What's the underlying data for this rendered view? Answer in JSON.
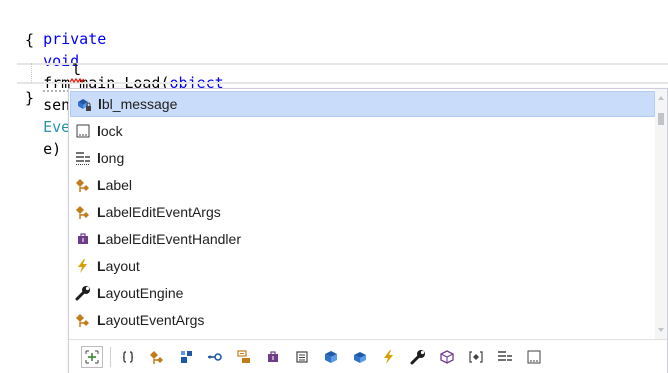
{
  "editor": {
    "line1": {
      "keyword_private": "private",
      "keyword_void": "void",
      "method_name": "frm_main_Load",
      "paren_open": "(",
      "keyword_object": "object",
      "param_sender": "sender",
      "comma": ",",
      "type_eventargs": "EventArgs",
      "param_e": "e",
      "paren_close": ")"
    },
    "open_brace": "{",
    "typed_text": "l",
    "close_brace": "}"
  },
  "completion": {
    "items": [
      {
        "prefix": "l",
        "rest": "bl_message",
        "icon": "private-field-icon",
        "selected": true
      },
      {
        "prefix": "l",
        "rest": "ock",
        "icon": "keyword-icon",
        "selected": false
      },
      {
        "prefix": "l",
        "rest": "ong",
        "icon": "keyword-struct-icon",
        "selected": false
      },
      {
        "prefix": "L",
        "rest": "abel",
        "icon": "class-icon",
        "selected": false
      },
      {
        "prefix": "L",
        "rest": "abelEditEventArgs",
        "icon": "class-icon",
        "selected": false
      },
      {
        "prefix": "L",
        "rest": "abelEditEventHandler",
        "icon": "delegate-icon",
        "selected": false
      },
      {
        "prefix": "L",
        "rest": "ayout",
        "icon": "event-icon",
        "selected": false
      },
      {
        "prefix": "L",
        "rest": "ayoutEngine",
        "icon": "property-wrench-icon",
        "selected": false
      },
      {
        "prefix": "L",
        "rest": "ayoutEventArgs",
        "icon": "class-icon",
        "selected": false
      }
    ],
    "filters": [
      "expander-filter-icon",
      "namespace-filter-icon",
      "class-filter-icon",
      "module-filter-icon",
      "interface-filter-icon",
      "enum-filter-icon",
      "delegate-filter-icon",
      "structure-filter-icon",
      "field-filter-icon",
      "event-filter-icon",
      "property-filter-icon",
      "extension-method-filter-icon",
      "local-filter-icon",
      "constant-filter-icon",
      "keyword-filter-icon"
    ]
  },
  "colors": {
    "keyword": "#0000ff",
    "type": "#2b91af",
    "selection": "#c9dcf9",
    "class_icon": "#c27d1a",
    "delegate_icon": "#6e3d8a",
    "event_icon": "#d6a100"
  }
}
